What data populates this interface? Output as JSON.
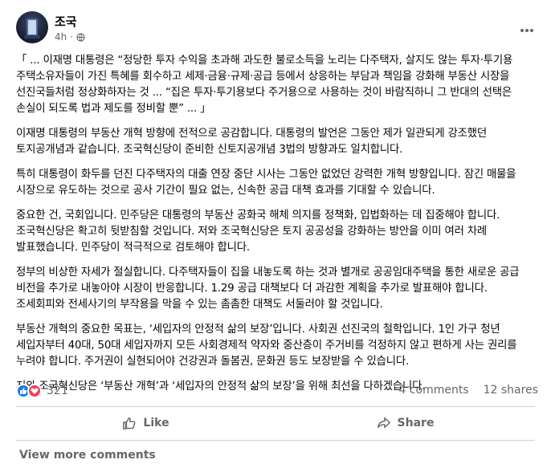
{
  "post": {
    "author": "조국",
    "time": "4h",
    "paragraphs": [
      "「 ... 이재명 대통령은 “정당한 투자 수익을 초과해 과도한 불로소득을 노리는 다주택자, 살지도 않는 투자·투기용 주택소유자들이 가진 특혜를 회수하고 세제·금융·규제·공급 등에서 상응하는 부담과 책임을 강화해 부동산 시장을 선진국들처럼 정상화하자는 것 ... “집은 투자·투기용보다 주거용으로 사용하는 것이 바람직하니 그 반대의 선택은 손실이 되도록 법과 제도를 정비할 뿐” ... 」",
      "이재명 대통령의 부동산 개혁 방향에 전적으로 공감합니다. 대통령의 발언은 그동안 제가 일관되게 강조했던 토지공개념과 같습니다. 조국혁신당이 준비한 신토지공개념 3법의 방향과도 일치합니다.",
      "특히 대통령이 화두를 던진 다주택자의 대출 연장 중단 시사는 그동안 없었던 강력한 개혁 방향입니다. 잠긴 매물을 시장으로 유도하는 것으로 공사 기간이 필요 없는, 신속한 공급 대책 효과를 기대할 수 있습니다.",
      "중요한 건, 국회입니다. 민주당은 대통령의 부동산 공화국 해체 의지를 정책화, 입법화하는 데 집중해야 합니다. 조국혁신당은 확고히 뒷받침할 것입니다. 저와 조국혁신당은 토지 공공성을 강화하는 방안을 이미 여러 차례 발표했습니다. 민주당이 적극적으로 검토해야 합니다.",
      "정부의 비상한 자세가 절실합니다. 다주택자들이 집을 내놓도록 하는 것과 별개로 공공임대주택을 통한 새로운 공급 비전을 추가로 내놓아야 시장이 반응합니다. 1.29 공급 대책보다 더 과감한 계획을 추가로 발표해야 합니다. 조세회피와 전세사기의 부작용을 막을 수 있는 촘촘한 대책도 서둘러야 할 것입니다.",
      "부동산 개혁의 중요한 목표는, ‘세입자의 안정적 삶의 보장’입니다. 사회권 선진국의 철학입니다. 1인 가구 청년 세입자부터 40대, 50대 세입자까지 모든 사회경제적 약자와 중산층이 주거비를 걱정하지 않고 편하게 사는 권리를 누려야 합니다. 주거권이 실현되어야 건강권과 돌봄권, 문화권 등도 보장받을 수 있습니다.",
      "저와 조국혁신당은 ‘부동산 개혁’과 ‘세입자의 안정적 삶의 보장’을 위해 최선을 다하겠습니다."
    ],
    "reaction_count": "321",
    "comments": "4 comments",
    "shares": "12 shares"
  },
  "actions": {
    "like_label": "Like",
    "share_label": "Share"
  },
  "footer": {
    "view_more": "View more comments"
  },
  "colors": {
    "like_blue": "#1877f2",
    "love_red": "#f33e58",
    "meta_gray": "#65676b"
  }
}
